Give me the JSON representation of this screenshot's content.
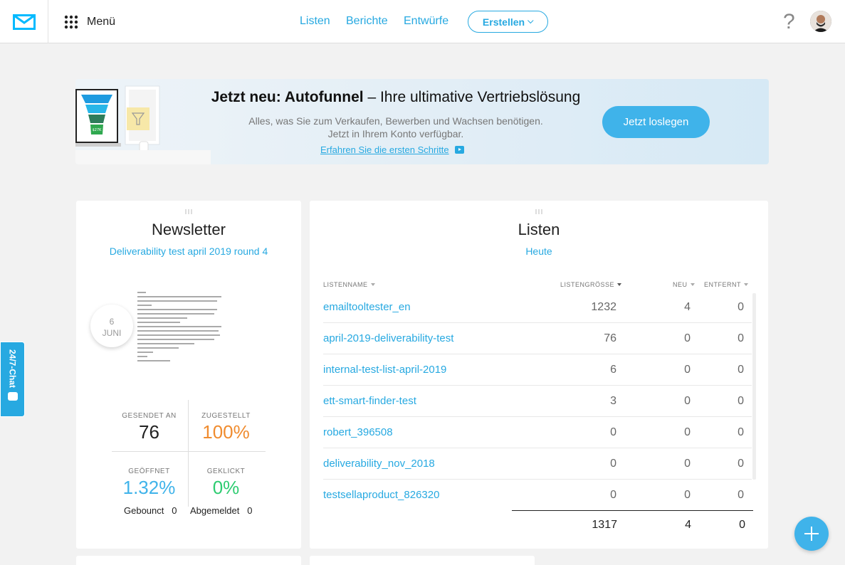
{
  "topbar": {
    "menu_label": "Menü",
    "nav": [
      "Listen",
      "Berichte",
      "Entwürfe"
    ],
    "create_label": "Erstellen",
    "help_glyph": "?"
  },
  "banner": {
    "title_bold": "Jetzt neu: Autofunnel",
    "title_rest": " – Ihre ultimative Vertriebslösung",
    "subtitle_1": "Alles, was Sie zum Verkaufen, Bewerben und Wachsen benötigen.",
    "subtitle_2": "Jetzt in Ihrem Konto verfügbar.",
    "link": "Erfahren Sie die ersten Schritte",
    "button": "Jetzt loslegen",
    "funnel_value": "$27K"
  },
  "newsletter": {
    "title": "Newsletter",
    "name": "Deliverability test april 2019 round 4",
    "date_day": "6",
    "date_month": "JUNI",
    "sent_label": "GESENDET AN",
    "sent_value": "76",
    "delivered_label": "ZUGESTELLT",
    "delivered_value": "100%",
    "opened_label": "GEÖFFNET",
    "opened_value": "1.32%",
    "clicked_label": "GEKLICKT",
    "clicked_value": "0%",
    "bounced_label": "Gebounct",
    "bounced_value": "0",
    "unsubscribed_label": "Abgemeldet",
    "unsubscribed_value": "0"
  },
  "lists": {
    "title": "Listen",
    "subtitle": "Heute",
    "columns": [
      "LISTENNAME",
      "LISTENGRÖSSE",
      "NEU",
      "ENTFERNT"
    ],
    "rows": [
      {
        "name": "emailtooltester_en",
        "size": "1232",
        "new": "4",
        "removed": "0"
      },
      {
        "name": "april-2019-deliverability-test",
        "size": "76",
        "new": "0",
        "removed": "0"
      },
      {
        "name": "internal-test-list-april-2019",
        "size": "6",
        "new": "0",
        "removed": "0"
      },
      {
        "name": "ett-smart-finder-test",
        "size": "3",
        "new": "0",
        "removed": "0"
      },
      {
        "name": "robert_396508",
        "size": "0",
        "new": "0",
        "removed": "0"
      },
      {
        "name": "deliverability_nov_2018",
        "size": "0",
        "new": "0",
        "removed": "0"
      },
      {
        "name": "testsellaproduct_826320",
        "size": "0",
        "new": "0",
        "removed": "0"
      }
    ],
    "totals": {
      "size": "1317",
      "new": "4",
      "removed": "0"
    }
  },
  "chat": {
    "label": "24/7-Chat"
  },
  "colors": {
    "accent": "#27a9e1",
    "orange": "#f08c2f",
    "brand": "#00baff"
  }
}
